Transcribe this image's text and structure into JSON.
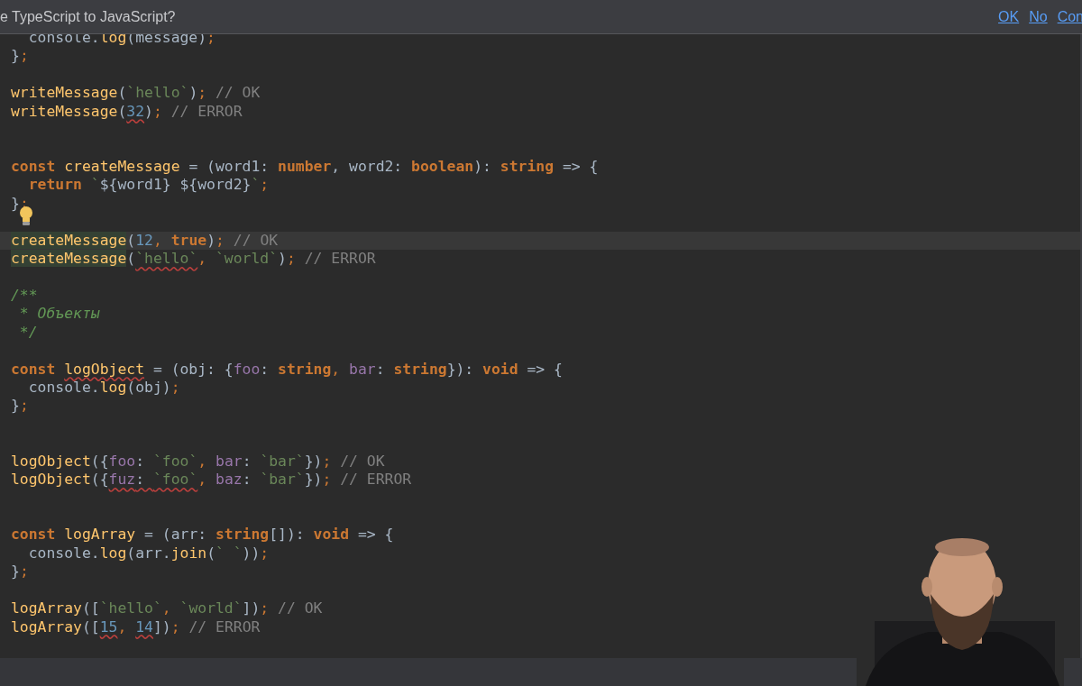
{
  "notification": {
    "text": "e TypeScript to JavaScript?",
    "links": [
      "OK",
      "No",
      "Con"
    ]
  },
  "editor": {
    "lines": [
      {
        "kind": "code",
        "current": false,
        "tokens": [
          {
            "text": "  console.",
            "kind": "plain",
            "error": false
          },
          {
            "text": "log",
            "kind": "fn",
            "error": false
          },
          {
            "text": "(message)",
            "kind": "plain",
            "error": false
          },
          {
            "text": ";",
            "kind": "punct",
            "error": false
          }
        ]
      },
      {
        "kind": "code",
        "current": false,
        "tokens": [
          {
            "text": "}",
            "kind": "plain",
            "error": false
          },
          {
            "text": ";",
            "kind": "punct",
            "error": false
          }
        ]
      },
      {
        "kind": "blank"
      },
      {
        "kind": "code",
        "current": false,
        "tokens": [
          {
            "text": "writeMessage",
            "kind": "fn",
            "error": false
          },
          {
            "text": "(",
            "kind": "plain",
            "error": false
          },
          {
            "text": "`hello`",
            "kind": "str",
            "error": false
          },
          {
            "text": ")",
            "kind": "plain",
            "error": false
          },
          {
            "text": ";",
            "kind": "punct",
            "error": false
          },
          {
            "text": " // OK",
            "kind": "cmt",
            "error": false
          }
        ]
      },
      {
        "kind": "code",
        "current": false,
        "tokens": [
          {
            "text": "writeMessage",
            "kind": "fn",
            "error": false
          },
          {
            "text": "(",
            "kind": "plain",
            "error": false
          },
          {
            "text": "32",
            "kind": "num",
            "error": true
          },
          {
            "text": ")",
            "kind": "plain",
            "error": false
          },
          {
            "text": ";",
            "kind": "punct",
            "error": false
          },
          {
            "text": " // ERROR",
            "kind": "cmt",
            "error": false
          }
        ]
      },
      {
        "kind": "blank"
      },
      {
        "kind": "blank"
      },
      {
        "kind": "code",
        "current": false,
        "tokens": [
          {
            "text": "const ",
            "kind": "kw",
            "error": false
          },
          {
            "text": "createMessage",
            "kind": "fn",
            "error": false
          },
          {
            "text": " = (word1: ",
            "kind": "plain",
            "error": false
          },
          {
            "text": "number",
            "kind": "kw",
            "error": false
          },
          {
            "text": ", word2: ",
            "kind": "plain",
            "error": false
          },
          {
            "text": "boolean",
            "kind": "kw",
            "error": false
          },
          {
            "text": "): ",
            "kind": "plain",
            "error": false
          },
          {
            "text": "string",
            "kind": "kw",
            "error": false
          },
          {
            "text": " => {",
            "kind": "plain",
            "error": false
          }
        ]
      },
      {
        "kind": "code",
        "current": false,
        "tokens": [
          {
            "text": "  return ",
            "kind": "kw",
            "error": false
          },
          {
            "text": "`",
            "kind": "str",
            "error": false
          },
          {
            "text": "${word1} ${word2}",
            "kind": "plain",
            "error": false
          },
          {
            "text": "`",
            "kind": "str",
            "error": false
          },
          {
            "text": ";",
            "kind": "punct",
            "error": false
          }
        ]
      },
      {
        "kind": "code",
        "current": false,
        "tokens": [
          {
            "text": "}",
            "kind": "plain",
            "error": false
          },
          {
            "text": ";",
            "kind": "punct",
            "error": false
          }
        ]
      },
      {
        "kind": "bulb"
      },
      {
        "kind": "code",
        "current": true,
        "tokens": [
          {
            "text": "createMessage",
            "kind": "usage",
            "error": false
          },
          {
            "text": "(",
            "kind": "plain",
            "error": false
          },
          {
            "text": "12",
            "kind": "num",
            "error": false
          },
          {
            "text": ", ",
            "kind": "punct",
            "error": false
          },
          {
            "text": "true",
            "kind": "kw",
            "error": false
          },
          {
            "text": ")",
            "kind": "plain",
            "error": false
          },
          {
            "text": ";",
            "kind": "punct",
            "error": false
          },
          {
            "text": " // OK",
            "kind": "cmt",
            "error": false
          }
        ]
      },
      {
        "kind": "code",
        "current": false,
        "tokens": [
          {
            "text": "createMessage",
            "kind": "usage",
            "error": false
          },
          {
            "text": "(",
            "kind": "plain",
            "error": false
          },
          {
            "text": "`hello`",
            "kind": "str",
            "error": true
          },
          {
            "text": ", ",
            "kind": "punct",
            "error": false
          },
          {
            "text": "`world`",
            "kind": "str",
            "error": false
          },
          {
            "text": ")",
            "kind": "plain",
            "error": false
          },
          {
            "text": ";",
            "kind": "punct",
            "error": false
          },
          {
            "text": " // ERROR",
            "kind": "cmt",
            "error": false
          }
        ]
      },
      {
        "kind": "blank"
      },
      {
        "kind": "code",
        "current": false,
        "tokens": [
          {
            "text": "/**",
            "kind": "doc",
            "error": false
          }
        ]
      },
      {
        "kind": "code",
        "current": false,
        "tokens": [
          {
            "text": " * Объекты",
            "kind": "doc",
            "error": false
          }
        ]
      },
      {
        "kind": "code",
        "current": false,
        "tokens": [
          {
            "text": " */",
            "kind": "doc",
            "error": false
          }
        ]
      },
      {
        "kind": "blank"
      },
      {
        "kind": "code",
        "current": false,
        "tokens": [
          {
            "text": "const ",
            "kind": "kw",
            "error": false
          },
          {
            "text": "logObject",
            "kind": "fn",
            "error": true
          },
          {
            "text": " = (obj: {",
            "kind": "plain",
            "error": false
          },
          {
            "text": "foo",
            "kind": "prop",
            "error": false
          },
          {
            "text": ": ",
            "kind": "plain",
            "error": false
          },
          {
            "text": "string",
            "kind": "kw",
            "error": false
          },
          {
            "text": ", ",
            "kind": "punct",
            "error": false
          },
          {
            "text": "bar",
            "kind": "prop",
            "error": false
          },
          {
            "text": ": ",
            "kind": "plain",
            "error": false
          },
          {
            "text": "string",
            "kind": "kw",
            "error": false
          },
          {
            "text": "}): ",
            "kind": "plain",
            "error": false
          },
          {
            "text": "void",
            "kind": "kw",
            "error": false
          },
          {
            "text": " => {",
            "kind": "plain",
            "error": false
          }
        ]
      },
      {
        "kind": "code",
        "current": false,
        "tokens": [
          {
            "text": "  console.",
            "kind": "plain",
            "error": false
          },
          {
            "text": "log",
            "kind": "fn",
            "error": false
          },
          {
            "text": "(obj)",
            "kind": "plain",
            "error": false
          },
          {
            "text": ";",
            "kind": "punct",
            "error": false
          }
        ]
      },
      {
        "kind": "code",
        "current": false,
        "tokens": [
          {
            "text": "}",
            "kind": "plain",
            "error": false
          },
          {
            "text": ";",
            "kind": "punct",
            "error": false
          }
        ]
      },
      {
        "kind": "blank"
      },
      {
        "kind": "blank"
      },
      {
        "kind": "code",
        "current": false,
        "tokens": [
          {
            "text": "logObject",
            "kind": "fn",
            "error": false
          },
          {
            "text": "({",
            "kind": "plain",
            "error": false
          },
          {
            "text": "foo",
            "kind": "prop",
            "error": false
          },
          {
            "text": ": ",
            "kind": "plain",
            "error": false
          },
          {
            "text": "`foo`",
            "kind": "str",
            "error": false
          },
          {
            "text": ", ",
            "kind": "punct",
            "error": false
          },
          {
            "text": "bar",
            "kind": "prop",
            "error": false
          },
          {
            "text": ": ",
            "kind": "plain",
            "error": false
          },
          {
            "text": "`bar`",
            "kind": "str",
            "error": false
          },
          {
            "text": "})",
            "kind": "plain",
            "error": false
          },
          {
            "text": ";",
            "kind": "punct",
            "error": false
          },
          {
            "text": " // OK",
            "kind": "cmt",
            "error": false
          }
        ]
      },
      {
        "kind": "code",
        "current": false,
        "tokens": [
          {
            "text": "logObject",
            "kind": "fn",
            "error": false
          },
          {
            "text": "({",
            "kind": "plain",
            "error": false
          },
          {
            "text": "fuz",
            "kind": "prop",
            "error": true
          },
          {
            "text": ": ",
            "kind": "plain",
            "error": true
          },
          {
            "text": "`foo`",
            "kind": "str",
            "error": true
          },
          {
            "text": ", ",
            "kind": "punct",
            "error": false
          },
          {
            "text": "baz",
            "kind": "prop",
            "error": false
          },
          {
            "text": ": ",
            "kind": "plain",
            "error": false
          },
          {
            "text": "`bar`",
            "kind": "str",
            "error": false
          },
          {
            "text": "})",
            "kind": "plain",
            "error": false
          },
          {
            "text": ";",
            "kind": "punct",
            "error": false
          },
          {
            "text": " // ERROR",
            "kind": "cmt",
            "error": false
          }
        ]
      },
      {
        "kind": "blank"
      },
      {
        "kind": "blank"
      },
      {
        "kind": "code",
        "current": false,
        "tokens": [
          {
            "text": "const ",
            "kind": "kw",
            "error": false
          },
          {
            "text": "logArray",
            "kind": "fn",
            "error": false
          },
          {
            "text": " = (arr: ",
            "kind": "plain",
            "error": false
          },
          {
            "text": "string",
            "kind": "kw",
            "error": false
          },
          {
            "text": "[]): ",
            "kind": "plain",
            "error": false
          },
          {
            "text": "void",
            "kind": "kw",
            "error": false
          },
          {
            "text": " => {",
            "kind": "plain",
            "error": false
          }
        ]
      },
      {
        "kind": "code",
        "current": false,
        "tokens": [
          {
            "text": "  console.",
            "kind": "plain",
            "error": false
          },
          {
            "text": "log",
            "kind": "fn",
            "error": false
          },
          {
            "text": "(arr.",
            "kind": "plain",
            "error": false
          },
          {
            "text": "join",
            "kind": "fn",
            "error": false
          },
          {
            "text": "(",
            "kind": "plain",
            "error": false
          },
          {
            "text": "` `",
            "kind": "str",
            "error": false
          },
          {
            "text": "))",
            "kind": "plain",
            "error": false
          },
          {
            "text": ";",
            "kind": "punct",
            "error": false
          }
        ]
      },
      {
        "kind": "code",
        "current": false,
        "tokens": [
          {
            "text": "}",
            "kind": "plain",
            "error": false
          },
          {
            "text": ";",
            "kind": "punct",
            "error": false
          }
        ]
      },
      {
        "kind": "blank"
      },
      {
        "kind": "code",
        "current": false,
        "tokens": [
          {
            "text": "logArray",
            "kind": "fn",
            "error": false
          },
          {
            "text": "([",
            "kind": "plain",
            "error": false
          },
          {
            "text": "`hello`",
            "kind": "str",
            "error": false
          },
          {
            "text": ", ",
            "kind": "punct",
            "error": false
          },
          {
            "text": "`world`",
            "kind": "str",
            "error": false
          },
          {
            "text": "])",
            "kind": "plain",
            "error": false
          },
          {
            "text": ";",
            "kind": "punct",
            "error": false
          },
          {
            "text": " // OK",
            "kind": "cmt",
            "error": false
          }
        ]
      },
      {
        "kind": "code",
        "current": false,
        "tokens": [
          {
            "text": "logArray",
            "kind": "fn",
            "error": false
          },
          {
            "text": "([",
            "kind": "plain",
            "error": false
          },
          {
            "text": "15",
            "kind": "num",
            "error": true
          },
          {
            "text": ", ",
            "kind": "punct",
            "error": false
          },
          {
            "text": "14",
            "kind": "num",
            "error": true
          },
          {
            "text": "])",
            "kind": "plain",
            "error": false
          },
          {
            "text": ";",
            "kind": "punct",
            "error": false
          },
          {
            "text": " // ERROR",
            "kind": "cmt",
            "error": false
          }
        ]
      }
    ]
  }
}
